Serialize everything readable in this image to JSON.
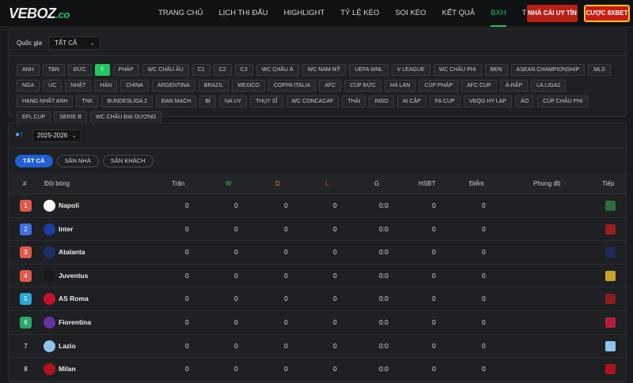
{
  "header": {
    "logo_main": "VEBOZ",
    "logo_suffix": ".co",
    "nav": [
      "TRANG CHỦ",
      "LỊCH THI ĐẤU",
      "HIGHLIGHT",
      "TỶ LỆ KÈO",
      "SOI KÈO",
      "KẾT QUẢ",
      "BXH",
      "TUYỂN DỤNG"
    ],
    "active_nav": 6,
    "btn_nha_cai": "NHÀ CÁI UY TÍN",
    "btn_cuoc": "CƯỢC 8XBET"
  },
  "filter": {
    "country_label": "Quốc gia",
    "country_value": "TẤT CẢ",
    "leagues": [
      "ANH",
      "TBN",
      "ĐỨC",
      "Ý",
      "PHÁP",
      "WC CHÂU ÂU",
      "C1",
      "C2",
      "C3",
      "WC CHÂU Á",
      "WC NAM MỸ",
      "UEFA WNL",
      "V LEAGUE",
      "WC CHÂU PHI",
      "BĐN",
      "ASEAN CHAMPIONSHIP",
      "MLS",
      "NGA",
      "ÚC",
      "NHẬT",
      "HÀN",
      "CHINA",
      "ARGENTINA",
      "BRAZIL",
      "MEXICO",
      "COPPA ITALIA",
      "AFC",
      "CÚP ĐỨC",
      "HÀ LAN",
      "CÚP PHÁP",
      "AFC CUP",
      "Ả-RẬP",
      "LA LIGA2",
      "HẠNG NHẤT ANH",
      "TNK",
      "BUNDESLIGA 2",
      "ĐAN MẠCH",
      "BỈ",
      "NA UY",
      "THỤY SĨ",
      "WC CONCACAF",
      "THÁI",
      "INDO",
      "AI CẬP",
      "FA CUP",
      "VĐQG HY LẠP",
      "ÁO",
      "CÚP CHÂU PHI",
      "EFL CUP",
      "SERIE B",
      "WC CHÂU ĐẠI DƯƠNG"
    ],
    "active_league": 3
  },
  "standings": {
    "season": "2025-2026",
    "tabs": [
      "TẤT CẢ",
      "SÂN NHÀ",
      "SÂN KHÁCH"
    ],
    "active_tab": 0,
    "columns": {
      "rank": "#",
      "team": "Đội bóng",
      "played": "Trận",
      "w": "W",
      "d": "D",
      "l": "L",
      "g": "G",
      "gd": "HSBT",
      "pts": "Điểm",
      "form": "Phong độ",
      "next": "Tiếp"
    },
    "rows": [
      {
        "rank": "1",
        "team": "Napoli",
        "played": "0",
        "w": "0",
        "d": "0",
        "l": "0",
        "g": "0:0",
        "gd": "0",
        "pts": "0"
      },
      {
        "rank": "2",
        "team": "Inter",
        "played": "0",
        "w": "0",
        "d": "0",
        "l": "0",
        "g": "0:0",
        "gd": "0",
        "pts": "0"
      },
      {
        "rank": "3",
        "team": "Atalanta",
        "played": "0",
        "w": "0",
        "d": "0",
        "l": "0",
        "g": "0:0",
        "gd": "0",
        "pts": "0"
      },
      {
        "rank": "4",
        "team": "Juventus",
        "played": "0",
        "w": "0",
        "d": "0",
        "l": "0",
        "g": "0:0",
        "gd": "0",
        "pts": "0"
      },
      {
        "rank": "5",
        "team": "AS Roma",
        "played": "0",
        "w": "0",
        "d": "0",
        "l": "0",
        "g": "0:0",
        "gd": "0",
        "pts": "0"
      },
      {
        "rank": "6",
        "team": "Fiorentina",
        "played": "0",
        "w": "0",
        "d": "0",
        "l": "0",
        "g": "0:0",
        "gd": "0",
        "pts": "0"
      },
      {
        "rank": "7",
        "team": "Lazio",
        "played": "0",
        "w": "0",
        "d": "0",
        "l": "0",
        "g": "0:0",
        "gd": "0",
        "pts": "0"
      },
      {
        "rank": "8",
        "team": "Milan",
        "played": "0",
        "w": "0",
        "d": "0",
        "l": "0",
        "g": "0:0",
        "gd": "0",
        "pts": "0"
      }
    ]
  },
  "colors": {
    "accent_green": "#22c55e",
    "tab_blue": "#1f5fd6",
    "btn_red": "#b81f17",
    "btn_gold_border": "#f2c01e",
    "col_w": "#22c55e",
    "col_d": "#e08a2a",
    "col_l": "#e0473a",
    "rank_colors": [
      "#e05a4b",
      "#3f6fe0",
      "#e05a4b",
      "#e05a4b",
      "#2aa8d8",
      "#2aa86a",
      "transparent",
      "transparent"
    ],
    "crest_colors": [
      "#ffffff",
      "#1b3fa0",
      "#1d2f6a",
      "#1a1a1a",
      "#c8102e",
      "#6b2ea0",
      "#8fc4ea",
      "#b0121b"
    ],
    "next_colors": [
      "#2c6e3a",
      "#9b1c1c",
      "#1c2a5c",
      "#c9a227",
      "#8c1c1c",
      "#b71c3c",
      "#8fc4ea",
      "#b0121b"
    ]
  }
}
